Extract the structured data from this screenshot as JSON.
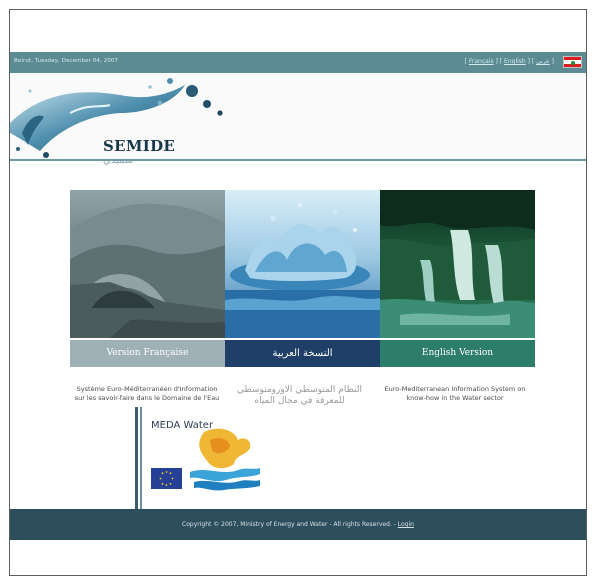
{
  "topbar": {
    "date": "Beirut, Tuesday, December 04, 2007",
    "lang_francais": "Français",
    "lang_english": "English",
    "lang_arabic": "عربي",
    "separator_open": "[",
    "separator_close": "]"
  },
  "header": {
    "logo_text": "SEMIDE",
    "logo_arabic": "سميدي"
  },
  "versions": {
    "fr_label": "Version Française",
    "ar_label": "النسخة العربية",
    "en_label": "English Version"
  },
  "descriptions": {
    "fr": "Système Euro-Méditerranéen d'Information sur les savoir-faire dans le Domaine de l'Eau",
    "ar": "النظام المتوسطي الاورومتوسطي للمعرفة في مجال المياه",
    "en": "Euro-Mediterranean Information System on know-how in the Water sector"
  },
  "meda": {
    "title": "MEDA Water"
  },
  "footer": {
    "copyright": "Copyright © 2007, Ministry of Energy and Water - All rights Reserved. - ",
    "login": "Login"
  },
  "colors": {
    "topbar": "#5c8b94",
    "footer": "#2d4f5d",
    "french_bar": "#9fb1b7",
    "arabic_bar": "#1f3f69",
    "english_bar": "#2c7e6a"
  }
}
